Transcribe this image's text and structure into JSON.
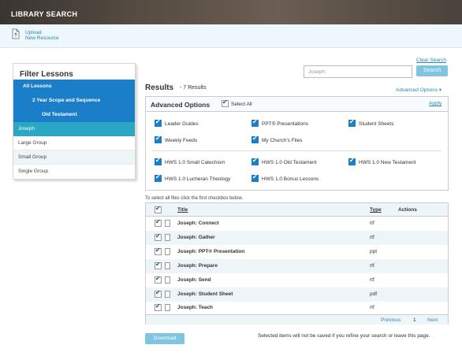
{
  "app": {
    "title": "LIBRARY SEARCH"
  },
  "upload": {
    "line1": "Upload",
    "line2": "New Resource"
  },
  "sidebar": {
    "title": "Filter Lessons",
    "items": [
      {
        "label": "All Lessons"
      },
      {
        "label": "2 Year Scope and Sequence"
      },
      {
        "label": "Old Testament"
      },
      {
        "label": "Joseph"
      },
      {
        "label": "Large Group"
      },
      {
        "label": "Small Group"
      },
      {
        "label": "Single Group"
      }
    ]
  },
  "search": {
    "value": "Joseph",
    "button": "Search",
    "clear": "Clear Search"
  },
  "results": {
    "title": "Results",
    "count": "- 7 Results",
    "adv_toggle": "Advanced Options ▾"
  },
  "advanced": {
    "title": "Advanced Options",
    "select_all": "Select All",
    "apply": "Apply",
    "options_row1": [
      "Leader Guides",
      "PPT® Presentations",
      "Student Sheets"
    ],
    "options_row2": [
      "Weekly Feeds",
      "My Church's Files"
    ],
    "options_row3": [
      "HWS 1.0 Small Catechism",
      "HWS 1.0 Old Testament",
      "HWS 1.0 New Testament"
    ],
    "options_row4": [
      "HWS 1.0 Lucheran Theology",
      "HWS 1.0 Bonus Lessons"
    ]
  },
  "hint": "To select all files click the first checkbox below.",
  "table": {
    "headers": {
      "title": "Title",
      "type": "Type",
      "actions": "Actions"
    },
    "rows": [
      {
        "title": "Joseph: Connect",
        "type": "rtf"
      },
      {
        "title": "Joseph: Gather",
        "type": "rtf"
      },
      {
        "title": "Joseph: PPT® Presentation",
        "type": "ppt"
      },
      {
        "title": "Joseph: Prepare",
        "type": "rtf"
      },
      {
        "title": "Joseph: Send",
        "type": "rtf"
      },
      {
        "title": "Joseph: Student Sheet",
        "type": "pdf"
      },
      {
        "title": "Joseph: Teach",
        "type": "rtf"
      }
    ],
    "pager": {
      "previous": "Previous",
      "page": "1",
      "next": "Next"
    }
  },
  "download": {
    "label": "Download"
  },
  "footer": {
    "note": "Selected items will not be saved if you refine your search or leave this page."
  },
  "colors": {
    "accent_blue": "#1a7ec8",
    "teal": "#2aa7c5",
    "light_button": "#7fc4e0",
    "link": "#2a8ab0"
  }
}
